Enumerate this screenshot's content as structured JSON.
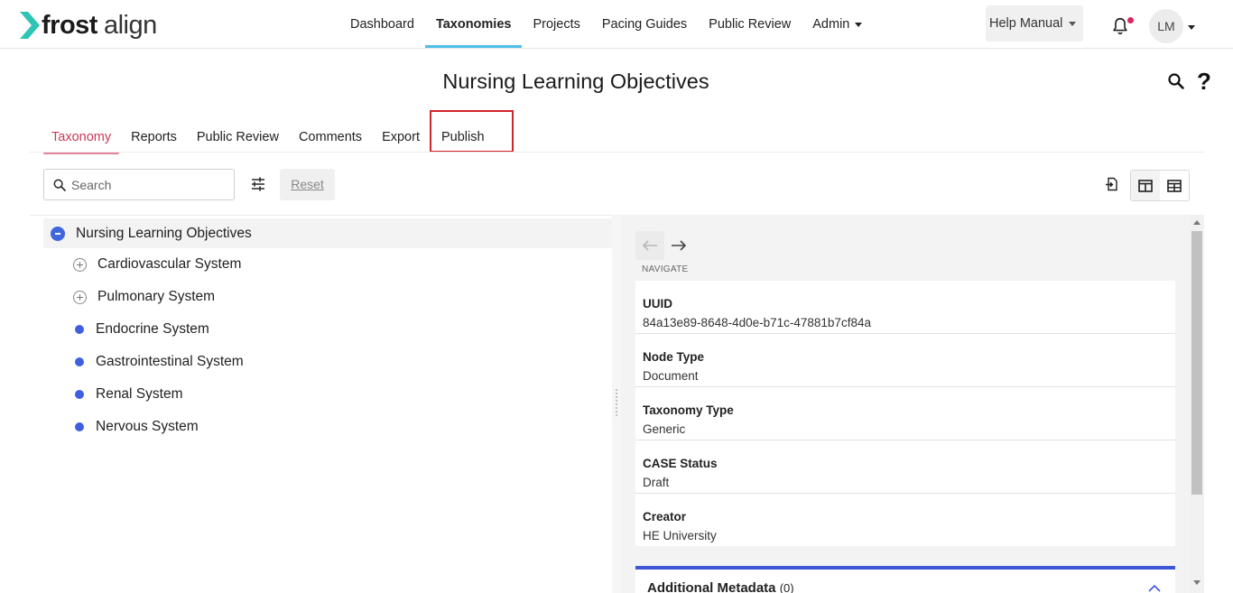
{
  "app": {
    "logo_bold": "frost",
    "logo_light": "align",
    "brand_color": "#2ec4b6"
  },
  "topnav": {
    "items": [
      {
        "label": "Dashboard"
      },
      {
        "label": "Taxonomies"
      },
      {
        "label": "Projects"
      },
      {
        "label": "Pacing Guides"
      },
      {
        "label": "Public Review"
      },
      {
        "label": "Admin"
      }
    ],
    "active": "Taxonomies",
    "help_label": "Help Manual",
    "notification_icon": "bell-icon",
    "user_initials": "LM"
  },
  "page": {
    "title": "Nursing Learning Objectives",
    "search_icon": "search-icon",
    "help_icon_glyph": "?"
  },
  "tabs": {
    "items": [
      {
        "label": "Taxonomy"
      },
      {
        "label": "Reports"
      },
      {
        "label": "Public Review"
      },
      {
        "label": "Comments"
      },
      {
        "label": "Export"
      },
      {
        "label": "Publish"
      }
    ],
    "active": "Taxonomy",
    "highlighted": "Publish",
    "active_color": "#c93a5a",
    "highlight_color": "#d2232a"
  },
  "toolbar": {
    "search_placeholder": "Search",
    "reset_label": "Reset"
  },
  "tree": {
    "root": "Nursing Learning Objectives",
    "children": [
      {
        "label": "Cardiovascular System",
        "type": "parent"
      },
      {
        "label": "Pulmonary System",
        "type": "parent"
      },
      {
        "label": "Endocrine System",
        "type": "leaf"
      },
      {
        "label": "Gastrointestinal System",
        "type": "leaf"
      },
      {
        "label": "Renal System",
        "type": "leaf"
      },
      {
        "label": "Nervous System",
        "type": "leaf"
      }
    ],
    "node_color": "#3f5fe0"
  },
  "details": {
    "navigate_label": "NAVIGATE",
    "fields": [
      {
        "key": "UUID",
        "value": "84a13e89-8648-4d0e-b71c-47881b7cf84a"
      },
      {
        "key": "Node Type",
        "value": "Document"
      },
      {
        "key": "Taxonomy Type",
        "value": "Generic"
      },
      {
        "key": "CASE Status",
        "value": "Draft"
      },
      {
        "key": "Creator",
        "value": "HE University"
      }
    ],
    "metadata_title": "Additional Metadata",
    "metadata_count": "(0)",
    "accent_color": "#3e57d6"
  }
}
